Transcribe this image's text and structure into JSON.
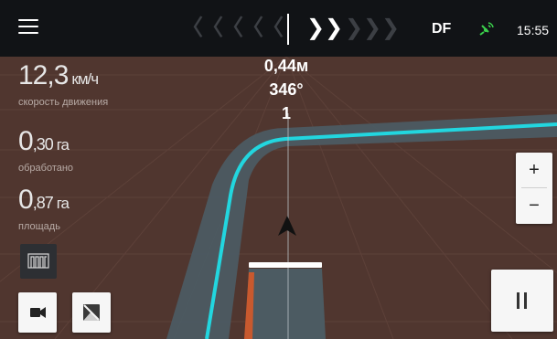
{
  "topbar": {
    "menu_icon": "hamburger-menu-icon",
    "guidance": {
      "left_chevrons": [
        "〈",
        "〈",
        "〈",
        "〈",
        "〈"
      ],
      "right_chevrons_active": [
        "❯",
        "❯"
      ],
      "right_chevrons_inactive": [
        "❯",
        "❯",
        "❯"
      ]
    },
    "mode_label": "DF",
    "gnss_icon": "satellite-signal-icon",
    "time": "15:55"
  },
  "metrics": [
    {
      "value": "12,3",
      "unit": "км/ч",
      "caption": "скорость движения"
    },
    {
      "value_big": "0",
      "value_small": ",30",
      "unit": "га",
      "caption": "обработано"
    },
    {
      "value_big": "0",
      "value_small": ",87",
      "unit": "га",
      "caption": "площадь"
    }
  ],
  "deviation": {
    "offset": "0,44м",
    "heading": "346°",
    "line_number": "1"
  },
  "zoom": {
    "in_label": "+",
    "out_label": "−"
  },
  "colors": {
    "background": "#50362f",
    "track": "#22d6df",
    "swath": "#4c5b62",
    "implement": "#ffffff",
    "coverage": "#c8592e",
    "topbar": "#111316"
  },
  "buttons": {
    "sections": "sections-icon",
    "camera": "video-camera-icon",
    "map_toggle": "map-photo-icon",
    "pause": "pause-icon"
  }
}
